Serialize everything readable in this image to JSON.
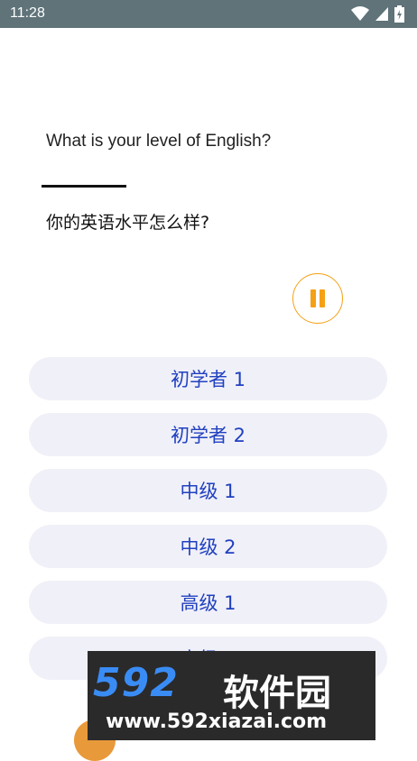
{
  "status_bar": {
    "time": "11:28",
    "icons": [
      "wifi-icon",
      "cellular-signal-icon",
      "battery-charging-icon"
    ]
  },
  "question": {
    "english": "What is your level of English?",
    "chinese": "你的英语水平怎么样?"
  },
  "audio": {
    "state": "playing",
    "icon": "pause-icon",
    "accent_color": "#f5a116"
  },
  "options": [
    {
      "label": "初学者 1"
    },
    {
      "label": "初学者 2"
    },
    {
      "label": "中级 1"
    },
    {
      "label": "中级 2"
    },
    {
      "label": "高级 1"
    },
    {
      "label": "高级 2"
    }
  ],
  "colors": {
    "status_bar": "#5f7379",
    "option_bg": "#f0f0f8",
    "option_text": "#2040c0"
  },
  "watermark": {
    "logo_text": "592软件园",
    "url": "www.592xiazai.com"
  }
}
